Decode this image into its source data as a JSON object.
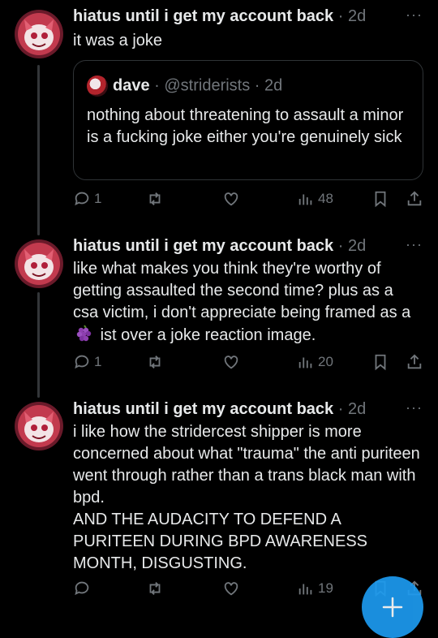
{
  "posts": [
    {
      "author": "hiatus until i get my account back",
      "time": "· 2d",
      "more": "···",
      "text": "it was a joke",
      "quote": {
        "author": "dave",
        "handle": "· @striderists · 2d",
        "text": "nothing about threatening to assault a minor is a fucking joke either you're genuinely sick"
      },
      "replies": "1",
      "views": "48"
    },
    {
      "author": "hiatus until i get my account back",
      "time": "· 2d",
      "more": "···",
      "text_before": "like what makes you think they're worthy of getting assaulted the second time? plus as a csa victim, i don't appreciate being framed as a",
      "text_after": "ist over a joke reaction image.",
      "replies": "1",
      "views": "20"
    },
    {
      "author": "hiatus until i get my account back",
      "time": "· 2d",
      "more": "···",
      "text": "i like how the stridercest shipper is more concerned about what \"trauma\" the anti puriteen went through rather than a trans black man with bpd.\nAND THE AUDACITY TO DEFEND A PURITEEN DURING BPD AWARENESS MONTH, DISGUSTING.",
      "views": "19"
    }
  ],
  "colors": {
    "accent": "#1d9bf0",
    "muted": "#71767b",
    "line": "#333639"
  }
}
